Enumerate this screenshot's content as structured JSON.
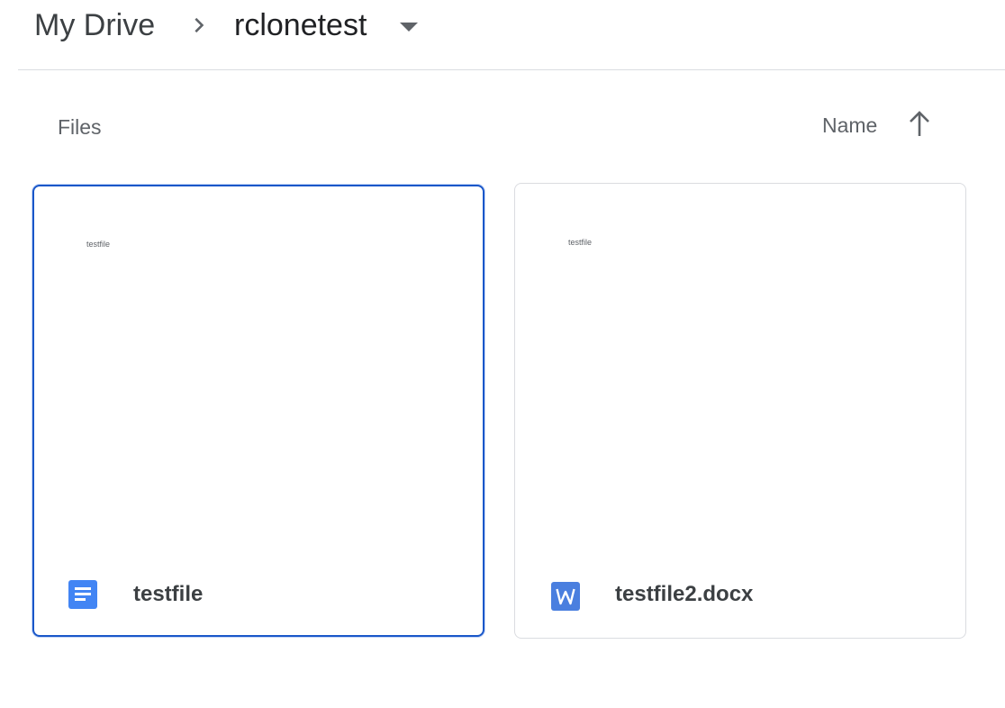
{
  "breadcrumb": {
    "root": "My Drive",
    "current": "rclonetest"
  },
  "section": {
    "title": "Files"
  },
  "sort": {
    "label": "Name",
    "direction_icon": "arrow-up-icon"
  },
  "files": [
    {
      "name": "testfile",
      "preview_text": "testfile",
      "type_icon": "google-docs-icon",
      "selected": true
    },
    {
      "name": "testfile2.docx",
      "preview_text": "testfile",
      "type_icon": "word-icon",
      "selected": false
    }
  ],
  "colors": {
    "accent": "#1a57c9",
    "docs_blue": "#4285f4",
    "word_blue": "#4a7fdf",
    "divider": "#dadce0"
  }
}
